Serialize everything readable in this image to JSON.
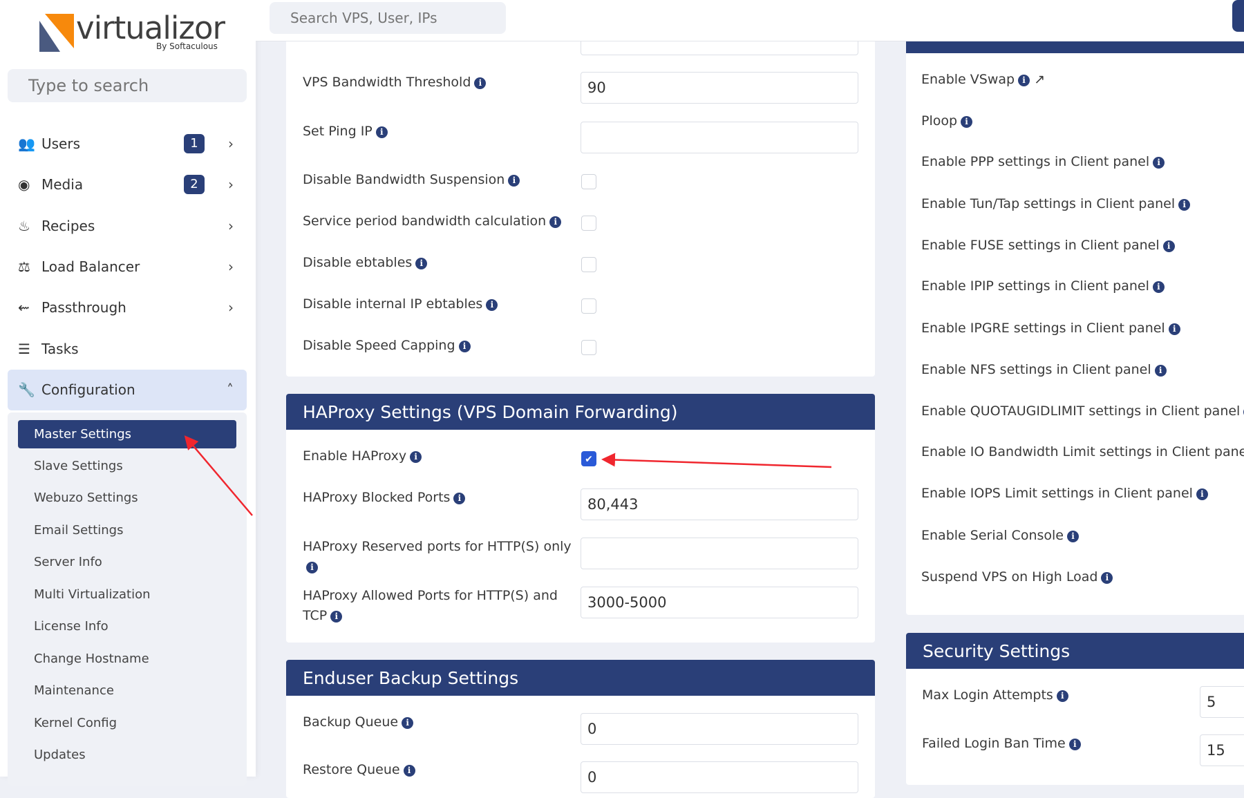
{
  "app": {
    "logo": "virtualizor",
    "logo_sub": "By Softaculous",
    "sidebar_search_placeholder": "Type to search",
    "top_search_placeholder": "Search VPS, User, IPs"
  },
  "sidebar": {
    "items": [
      {
        "label": "Users",
        "icon": "users-icon",
        "badge": "1"
      },
      {
        "label": "Media",
        "icon": "disc-icon",
        "badge": "2"
      },
      {
        "label": "Recipes",
        "icon": "recipe-icon"
      },
      {
        "label": "Load Balancer",
        "icon": "balance-icon"
      },
      {
        "label": "Passthrough",
        "icon": "usb-icon"
      },
      {
        "label": "Tasks",
        "icon": "tasks-icon"
      }
    ],
    "config": {
      "label": "Configuration",
      "sub": [
        "Master Settings",
        "Slave Settings",
        "Webuzo Settings",
        "Email Settings",
        "Server Info",
        "Multi Virtualization",
        "License Info",
        "Change Hostname",
        "Maintenance",
        "Kernel Config",
        "Updates"
      ]
    }
  },
  "middle": {
    "rows": [
      {
        "label": "VPS Bandwidth Threshold",
        "value": "90"
      },
      {
        "label": "Set Ping IP",
        "value": ""
      }
    ],
    "checks": [
      "Disable Bandwidth Suspension",
      "Service period bandwidth calculation",
      "Disable ebtables",
      "Disable internal IP ebtables",
      "Disable Speed Capping"
    ],
    "haproxy": {
      "title": "HAProxy Settings (VPS Domain Forwarding)",
      "enable_label": "Enable HAProxy",
      "enable_checked": true,
      "blocked_label": "HAProxy Blocked Ports",
      "blocked_value": "80,443",
      "reserved_label": "HAProxy Reserved ports for HTTP(S) only",
      "reserved_value": "",
      "allowed_label": "HAProxy Allowed Ports for HTTP(S) and TCP",
      "allowed_value": "3000-5000"
    },
    "backup": {
      "title": "Enduser Backup Settings",
      "queue_label": "Backup Queue",
      "queue_value": "0",
      "restore_label": "Restore Queue",
      "restore_value": "0"
    }
  },
  "right": {
    "items": [
      "Enable VSwap",
      "Ploop",
      "Enable PPP settings in Client panel",
      "Enable Tun/Tap settings in Client panel",
      "Enable FUSE settings in Client panel",
      "Enable IPIP settings in Client panel",
      "Enable IPGRE settings in Client panel",
      "Enable NFS settings in Client panel",
      "Enable QUOTAUGIDLIMIT settings in Client panel",
      "Enable IO Bandwidth Limit settings in Client panel",
      "Enable IOPS Limit settings in Client panel",
      "Enable Serial Console",
      "Suspend VPS on High Load"
    ],
    "security": {
      "title": "Security Settings",
      "max_login_label": "Max Login Attempts",
      "max_login_value": "5",
      "ban_label": "Failed Login Ban Time",
      "ban_value": "15"
    }
  }
}
